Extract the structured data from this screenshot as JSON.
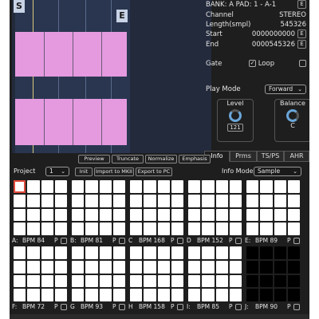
{
  "waveform": {
    "start_marker": "S",
    "end_marker": "E",
    "color": "#e59ae0"
  },
  "info": {
    "bank_pad": "BANK: A PAD: 1 - A-1",
    "channel_label": "Channel",
    "channel_value": "STEREO",
    "length_label": "Length(smpl)",
    "length_value": "545326",
    "start_label": "Start",
    "start_value": "0000000000",
    "end_label": "End",
    "end_value": "0000545326",
    "edit_label": "E",
    "gate_label": "Gate",
    "loop_label": "Loop",
    "loop_checked": true,
    "playmode_label": "Play Mode",
    "playmode_value": "Forward",
    "level_label": "Level",
    "level_value": "121",
    "balance_label": "Balance",
    "balance_value": "C"
  },
  "tabs": [
    "Info",
    "Prms",
    "TS/PS",
    "AHR"
  ],
  "active_tab": "Info",
  "toolbar": {
    "preview": "Preview",
    "truncate": "Truncate",
    "normalize": "Normalize",
    "emphasis": "Emphasis",
    "project_label": "Project",
    "project_value": "1",
    "init": "Init",
    "import_mkii": "Import to MKII",
    "export_pc": "Export to PC",
    "info_mode_label": "Info Mode",
    "info_mode_value": "Sample"
  },
  "banks": [
    {
      "letter": "A:",
      "bpm": "BPM 84"
    },
    {
      "letter": "B:",
      "bpm": "BPM 81"
    },
    {
      "letter": "C",
      "bpm": "BPM 168"
    },
    {
      "letter": "D",
      "bpm": "BPM 152"
    },
    {
      "letter": "E:",
      "bpm": "BPM 89"
    },
    {
      "letter": "F:",
      "bpm": "BPM 72"
    },
    {
      "letter": "G",
      "bpm": "BPM 93"
    },
    {
      "letter": "H",
      "bpm": "BPM 158"
    },
    {
      "letter": "I:",
      "bpm": "BPM 85"
    },
    {
      "letter": "J:",
      "bpm": "BPM 90"
    }
  ],
  "bank_p_label": "P",
  "accent_color": "#e24a3b"
}
